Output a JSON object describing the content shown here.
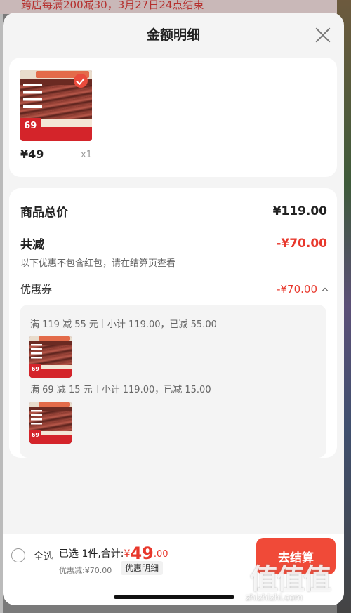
{
  "background": {
    "banner_text": "跨店每满200减30，3月27日24点结束"
  },
  "sheet": {
    "title": "金额明细"
  },
  "product": {
    "price": "¥49",
    "quantity": "x1",
    "thumb_price": "69",
    "thumb_label": "牛肉饼80g*10片",
    "thumb_slogan": "领券抢多件 到手价更低",
    "tags": [
      "99%牛肉",
      "0添加",
      "2:8肥瘦",
      "配料纯净"
    ]
  },
  "summary": {
    "total_label": "商品总价",
    "total_value": "¥119.00",
    "reduce_label": "共减",
    "reduce_value": "-¥70.00",
    "reduce_note": "以下优惠不包含红包，请在结算页查看",
    "coupon_label": "优惠券",
    "coupon_value": "-¥70.00"
  },
  "coupons": [
    {
      "rule": "满 119 减 55 元",
      "detail": "小计 119.00，已减 55.00"
    },
    {
      "rule": "满 69 减 15 元",
      "detail": "小计 119.00，已减 15.00"
    }
  ],
  "footer": {
    "select_all": "全选",
    "selected_text": "已选 1件,合计:",
    "currency": "¥",
    "amount_int": "49",
    "amount_dec": ".00",
    "discount_text": "优惠减:¥70.00",
    "detail_button": "优惠明细",
    "pay_button": "去结算"
  },
  "watermark": {
    "logo": "值值值",
    "url": "zhizhizhi.com"
  },
  "colors": {
    "accent": "#e8382c",
    "pay_button": "#f04a38"
  }
}
